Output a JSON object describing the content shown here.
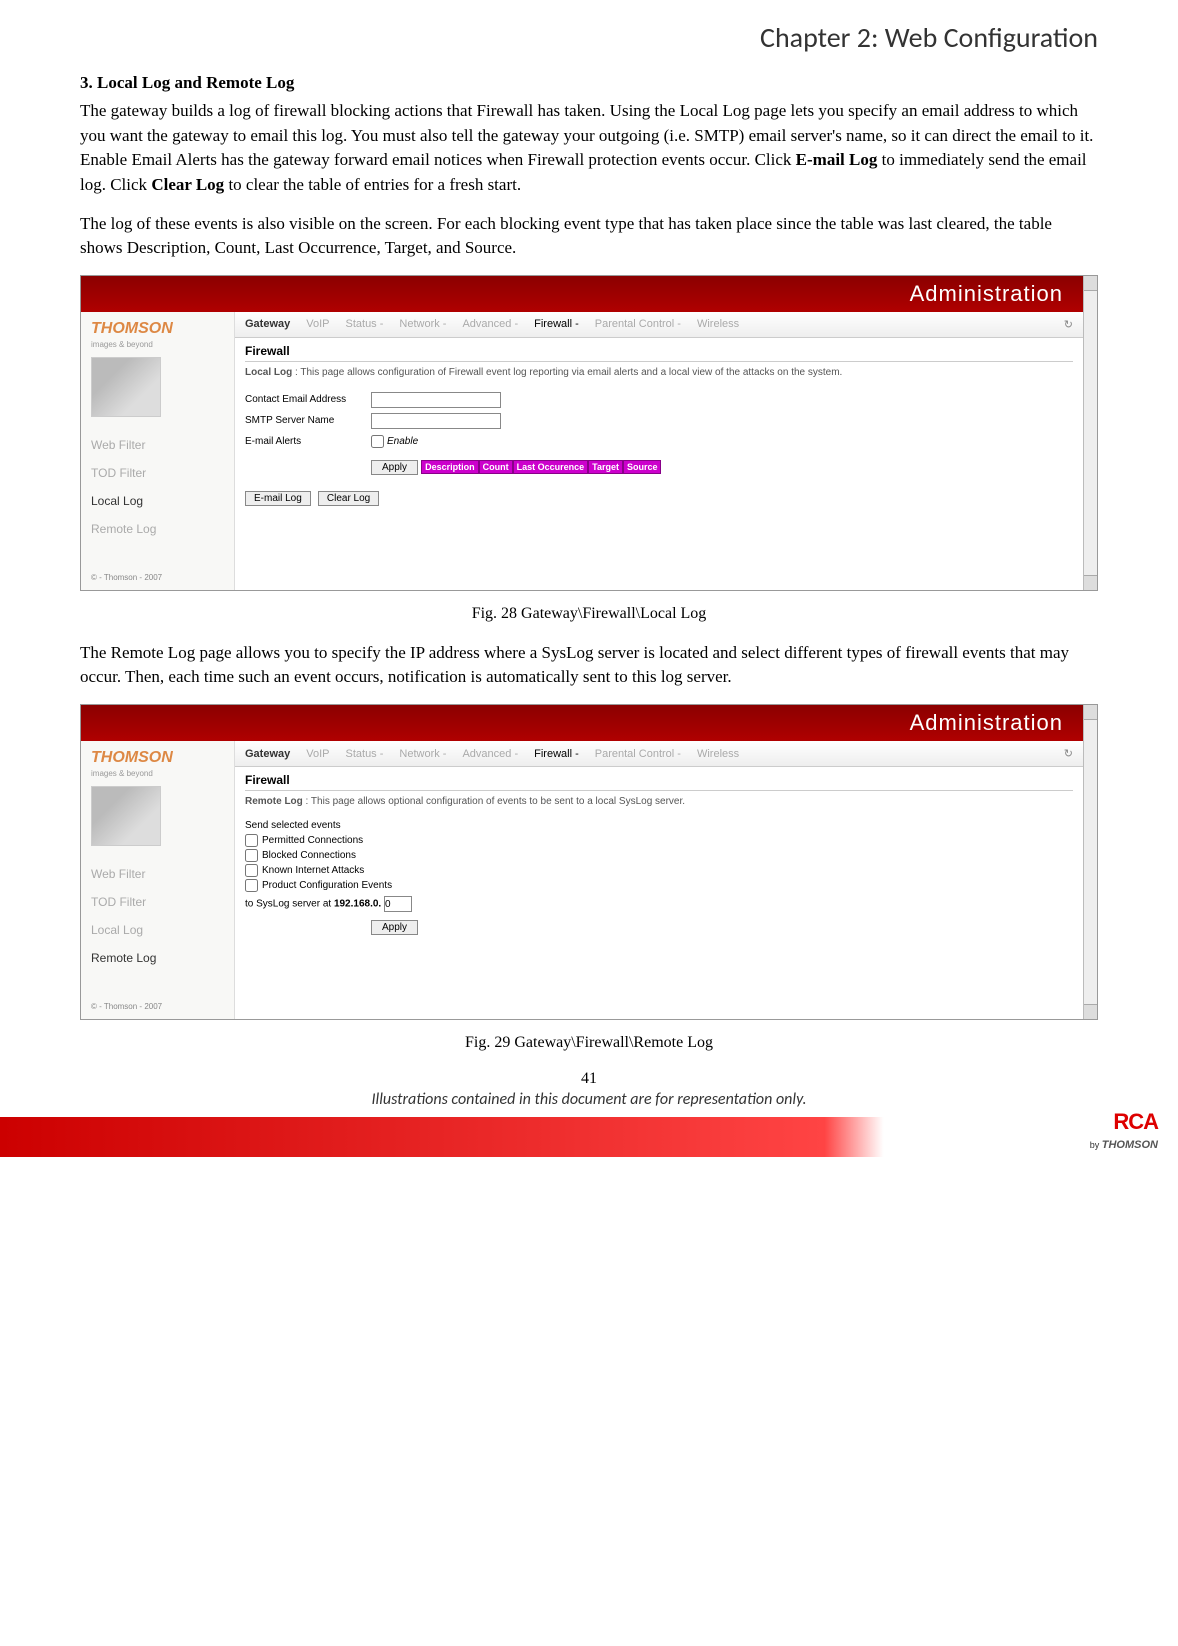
{
  "chapter_title": "Chapter 2: Web Configuration",
  "section_heading": "3. Local Log and Remote Log",
  "para1_a": "The gateway builds a log of firewall blocking actions that Firewall has taken.   Using the Local Log page lets you specify an email address to which you want the gateway to email this log. You must also tell the gateway your outgoing (i.e. SMTP) email server's name, so it can direct the email to it. Enable Email Alerts has the gateway forward email notices when Firewall protection events occur. Click ",
  "para1_b1": "E-mail Log",
  "para1_c": " to immediately send the email log. Click ",
  "para1_b2": "Clear Log",
  "para1_d": " to clear the table of entries for a fresh start.",
  "para2": "The log of these events is also visible on the screen. For each blocking event type that has taken place since the table was last cleared, the table shows Description, Count, Last Occurrence, Target, and Source.",
  "fig28_caption": "Fig. 28 Gateway\\Firewall\\Local Log",
  "para3": "The Remote Log page allows you to specify the IP address where a SysLog server is located and select different types of firewall events that may occur. Then, each time such an event occurs, notification is automatically sent to this log server.",
  "fig29_caption": "Fig. 29 Gateway\\Firewall\\Remote Log",
  "page_number": "41",
  "disclaimer": "Illustrations contained in this document are for representation only.",
  "footer": {
    "rca": "RCA",
    "by": "by ",
    "thomson": "THOMSON"
  },
  "shot_common": {
    "header_title": "Administration",
    "brand": "THOMSON",
    "brand_tag": "images & beyond",
    "tabs": {
      "gateway": "Gateway",
      "voip": "VoIP",
      "status": "Status -",
      "network": "Network -",
      "advanced": "Advanced -",
      "firewall": "Firewall -",
      "parental": "Parental Control -",
      "wireless": "Wireless"
    },
    "sidebar": {
      "web_filter": "Web Filter",
      "tod_filter": "TOD Filter",
      "local_log": "Local Log",
      "remote_log": "Remote Log"
    },
    "side_footer": "© - Thomson - 2007",
    "content_title": "Firewall"
  },
  "shot28": {
    "desc_b": "Local Log",
    "desc": " :  This page allows configuration of Firewall event log reporting via email alerts and a local view of the attacks on the system.",
    "contact_label": "Contact Email Address",
    "smtp_label": "SMTP Server Name",
    "alerts_label": "E-mail Alerts",
    "enable_label": "Enable",
    "apply_label": "Apply",
    "table_headers": [
      "Description",
      "Count",
      "Last Occurence",
      "Target",
      "Source"
    ],
    "email_log_btn": "E-mail Log",
    "clear_log_btn": "Clear Log"
  },
  "shot29": {
    "desc_b": "Remote Log",
    "desc": " :  This page allows optional configuration of events to be sent to a local SysLog server.",
    "send_label": "Send selected events",
    "opt1": "Permitted Connections",
    "opt2": "Blocked Connections",
    "opt3": "Known Internet Attacks",
    "opt4": "Product Configuration Events",
    "syslog_prefix": "to SysLog server at ",
    "syslog_ip": "192.168.0.",
    "syslog_val": "0",
    "apply_label": "Apply"
  }
}
